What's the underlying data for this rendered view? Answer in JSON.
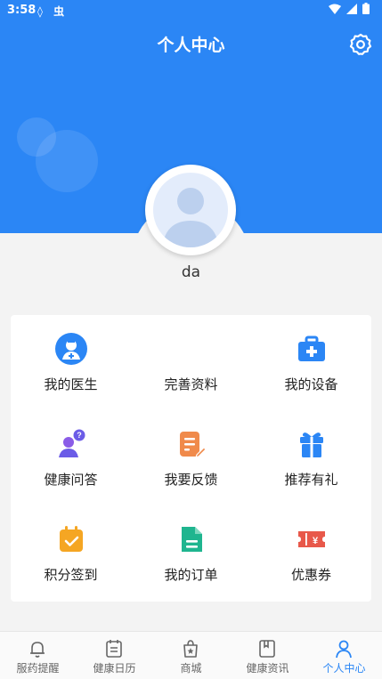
{
  "status_bar": {
    "time": "3:58",
    "icons": "◊ 虫"
  },
  "header": {
    "title": "个人中心"
  },
  "profile": {
    "username": "da"
  },
  "grid": [
    {
      "label": "我的医生",
      "icon": "doctor-icon"
    },
    {
      "label": "完善资料",
      "icon": "profile-edit-icon"
    },
    {
      "label": "我的设备",
      "icon": "medical-kit-icon"
    },
    {
      "label": "健康问答",
      "icon": "qa-icon"
    },
    {
      "label": "我要反馈",
      "icon": "feedback-icon"
    },
    {
      "label": "推荐有礼",
      "icon": "gift-icon"
    },
    {
      "label": "积分签到",
      "icon": "checkin-icon"
    },
    {
      "label": "我的订单",
      "icon": "order-icon"
    },
    {
      "label": "优惠券",
      "icon": "coupon-icon"
    }
  ],
  "nav": [
    {
      "label": "服药提醒",
      "icon": "bell-icon"
    },
    {
      "label": "健康日历",
      "icon": "calendar-icon"
    },
    {
      "label": "商城",
      "icon": "shop-bag-icon"
    },
    {
      "label": "健康资讯",
      "icon": "news-icon"
    },
    {
      "label": "个人中心",
      "icon": "person-icon",
      "active": true
    }
  ],
  "colors": {
    "primary": "#2b86f5",
    "orange": "#f5a623",
    "red": "#e8584a",
    "green": "#1fb58f",
    "purple": "#6b5ce7"
  }
}
